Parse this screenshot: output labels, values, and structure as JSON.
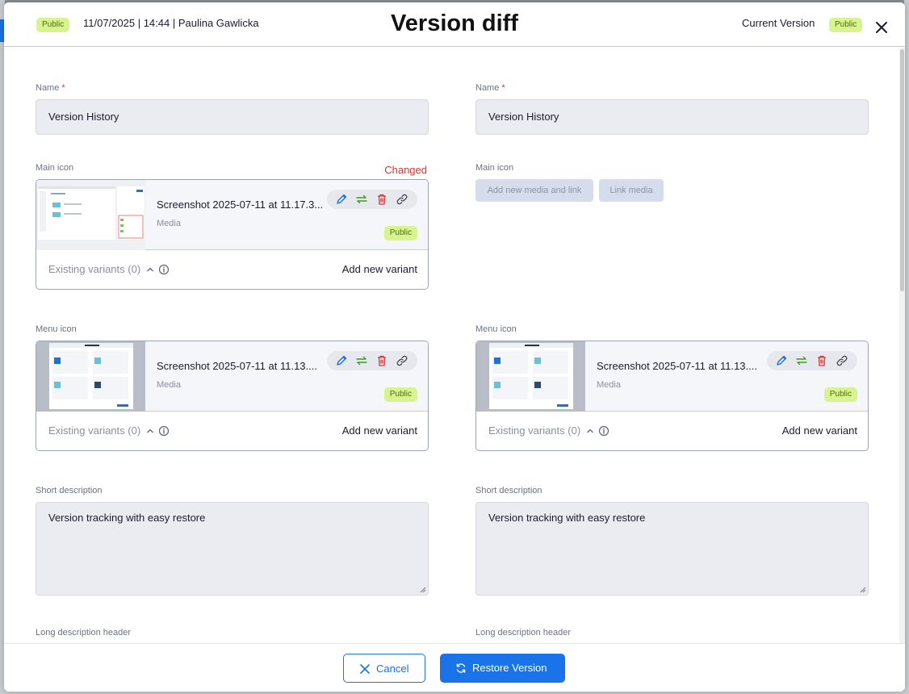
{
  "header": {
    "left_badge": "Public",
    "meta": "11/07/2025 | 14:44 | Paulina Gawlicka",
    "title": "Version diff",
    "current_label": "Current Version",
    "right_badge": "Public"
  },
  "left": {
    "name": {
      "label": "Name",
      "required": "*",
      "value": "Version History"
    },
    "main_icon": {
      "label": "Main icon",
      "changed": "Changed",
      "media_name": "Screenshot 2025-07-11 at 11.17.3...",
      "media_type": "Media",
      "badge": "Public",
      "variants": "Existing variants (0)",
      "add_variant": "Add new variant"
    },
    "menu_icon": {
      "label": "Menu icon",
      "media_name": "Screenshot 2025-07-11 at 11.13....",
      "media_type": "Media",
      "badge": "Public",
      "variants": "Existing variants (0)",
      "add_variant": "Add new variant"
    },
    "short_description": {
      "label": "Short description",
      "value": "Version tracking with easy restore"
    },
    "long_description_header": {
      "label": "Long description header"
    }
  },
  "right": {
    "name": {
      "label": "Name",
      "required": "*",
      "value": "Version History"
    },
    "main_icon": {
      "label": "Main icon",
      "add_new_media": "Add new media and link",
      "link_media": "Link media"
    },
    "menu_icon": {
      "label": "Menu icon",
      "media_name": "Screenshot 2025-07-11 at 11.13....",
      "media_type": "Media",
      "badge": "Public",
      "variants": "Existing variants (0)",
      "add_variant": "Add new variant"
    },
    "short_description": {
      "label": "Short description",
      "value": "Version tracking with easy restore"
    },
    "long_description_header": {
      "label": "Long description header"
    }
  },
  "footer": {
    "cancel": "Cancel",
    "restore": "Restore Version"
  },
  "colors": {
    "accent": "#1a73e8",
    "badge_bg": "#d8f48e",
    "changed": "#e03131",
    "edit_icon": "#1d70e0",
    "replace_icon": "#3f9a2a",
    "delete_icon": "#e03131"
  },
  "icons": [
    "close-icon",
    "pencil-icon",
    "replace-icon",
    "trash-icon",
    "link-icon",
    "chevron-up-icon",
    "info-icon",
    "x-icon",
    "refresh-icon"
  ]
}
